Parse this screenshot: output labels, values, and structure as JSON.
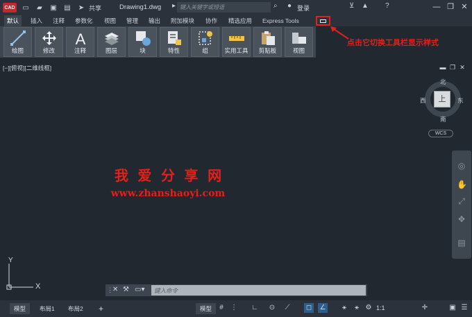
{
  "app": {
    "logo": "CAD",
    "share": "共享",
    "doc_name": "Drawing1.dwg",
    "search_placeholder": "键入关键字或短语",
    "login": "登录"
  },
  "tabs": [
    "默认",
    "插入",
    "注释",
    "参数化",
    "视图",
    "管理",
    "输出",
    "附加模块",
    "协作",
    "精选应用",
    "Express Tools"
  ],
  "ribbon": [
    "绘图",
    "修改",
    "注释",
    "图层",
    "块",
    "特性",
    "组",
    "实用工具",
    "剪贴板",
    "视图"
  ],
  "annotation": "点击它切换工具栏显示样式",
  "viewport": {
    "label": "[−][俯视][二维线框]"
  },
  "viewcube": {
    "north": "北",
    "south": "南",
    "east": "东",
    "west": "西",
    "top": "上",
    "wcs": "WCS"
  },
  "watermark": {
    "title": "我 爱 分 享 网",
    "url": "www.zhanshaoyi.com"
  },
  "ucs": {
    "x": "X",
    "y": "Y"
  },
  "command": {
    "placeholder": "键入命令"
  },
  "layouts": [
    "模型",
    "布局1",
    "布局2"
  ],
  "status": {
    "model": "模型",
    "scale": "1:1"
  },
  "colors": {
    "annotation": "#e3201b",
    "background": "#212830"
  }
}
